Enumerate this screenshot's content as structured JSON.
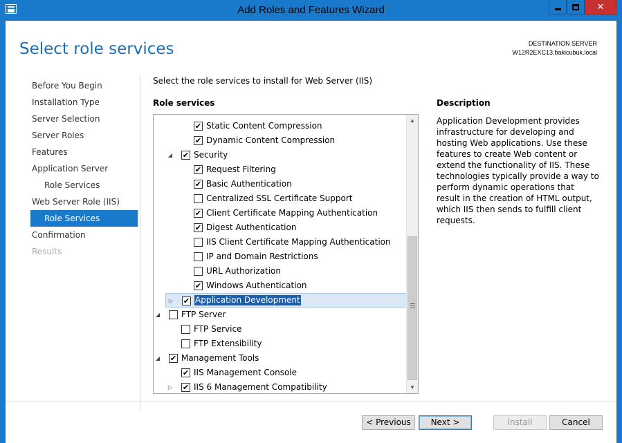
{
  "window": {
    "title": "Add Roles and Features Wizard",
    "close_glyph": "✕"
  },
  "header": {
    "page_title": "Select role services",
    "destination_label": "DESTINATION SERVER",
    "destination_server": "W12R2EXC13.bakicubuk.local"
  },
  "nav": {
    "items": [
      {
        "label": "Before You Begin",
        "state": "normal",
        "level": 0
      },
      {
        "label": "Installation Type",
        "state": "normal",
        "level": 0
      },
      {
        "label": "Server Selection",
        "state": "normal",
        "level": 0
      },
      {
        "label": "Server Roles",
        "state": "normal",
        "level": 0
      },
      {
        "label": "Features",
        "state": "normal",
        "level": 0
      },
      {
        "label": "Application Server",
        "state": "normal",
        "level": 0
      },
      {
        "label": "Role Services",
        "state": "normal",
        "level": 1
      },
      {
        "label": "Web Server Role (IIS)",
        "state": "normal",
        "level": 0
      },
      {
        "label": "Role Services",
        "state": "active",
        "level": 1
      },
      {
        "label": "Confirmation",
        "state": "normal",
        "level": 0
      },
      {
        "label": "Results",
        "state": "disabled",
        "level": 0
      }
    ]
  },
  "main": {
    "instruction": "Select the role services to install for Web Server (IIS)",
    "role_services_heading": "Role services",
    "tree": [
      {
        "label": "Static Content Compression",
        "checked": true,
        "level": 3,
        "expander": ""
      },
      {
        "label": "Dynamic Content Compression",
        "checked": true,
        "level": 3,
        "expander": ""
      },
      {
        "label": "Security",
        "checked": true,
        "level": 2,
        "expander": "◢"
      },
      {
        "label": "Request Filtering",
        "checked": true,
        "level": 3,
        "expander": ""
      },
      {
        "label": "Basic Authentication",
        "checked": true,
        "level": 3,
        "expander": ""
      },
      {
        "label": "Centralized SSL Certificate Support",
        "checked": false,
        "level": 3,
        "expander": ""
      },
      {
        "label": "Client Certificate Mapping Authentication",
        "checked": true,
        "level": 3,
        "expander": ""
      },
      {
        "label": "Digest Authentication",
        "checked": true,
        "level": 3,
        "expander": ""
      },
      {
        "label": "IIS Client Certificate Mapping Authentication",
        "checked": false,
        "level": 3,
        "expander": ""
      },
      {
        "label": "IP and Domain Restrictions",
        "checked": false,
        "level": 3,
        "expander": ""
      },
      {
        "label": "URL Authorization",
        "checked": false,
        "level": 3,
        "expander": ""
      },
      {
        "label": "Windows Authentication",
        "checked": true,
        "level": 3,
        "expander": ""
      },
      {
        "label": "Application Development",
        "checked": true,
        "level": 2,
        "expander": "▷",
        "selected": true
      },
      {
        "label": "FTP Server",
        "checked": false,
        "level": 1,
        "expander": "◢"
      },
      {
        "label": "FTP Service",
        "checked": false,
        "level": 2,
        "expander": ""
      },
      {
        "label": "FTP Extensibility",
        "checked": false,
        "level": 2,
        "expander": ""
      },
      {
        "label": "Management Tools",
        "checked": true,
        "level": 1,
        "expander": "◢"
      },
      {
        "label": "IIS Management Console",
        "checked": true,
        "level": 2,
        "expander": ""
      },
      {
        "label": "IIS 6 Management Compatibility",
        "checked": true,
        "level": 2,
        "expander": "▷"
      }
    ],
    "check_glyph": "✔",
    "scroll_up_glyph": "▲",
    "scroll_down_glyph": "▼"
  },
  "description": {
    "heading": "Description",
    "text": "Application Development provides infrastructure for developing and hosting Web applications. Use these features to create Web content or extend the functionality of IIS. These technologies typically provide a way to perform dynamic operations that result in the creation of HTML output, which IIS then sends to fulfill client requests."
  },
  "footer": {
    "previous_label": "< Previous",
    "next_label": "Next >",
    "install_label": "Install",
    "cancel_label": "Cancel"
  }
}
